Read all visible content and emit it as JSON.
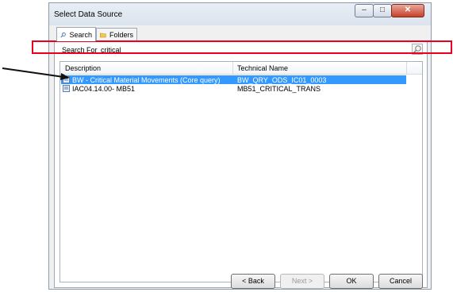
{
  "window": {
    "title": "Select Data Source"
  },
  "tabs": [
    {
      "label": "Search",
      "icon": "search-icon"
    },
    {
      "label": "Folders",
      "icon": "folder-icon"
    }
  ],
  "search": {
    "label": "Search For",
    "value": "critical"
  },
  "grid": {
    "columns": [
      "Description",
      "Technical Name"
    ],
    "rows": [
      {
        "description": "BW - Critical Material Movements (Core query)",
        "technical_name": "BW_QRY_ODS_IC01_0003",
        "selected": true
      },
      {
        "description": "IAC04.14.00- MB51",
        "technical_name": "MB51_CRITICAL_TRANS",
        "selected": false
      }
    ]
  },
  "buttons": {
    "back": "< Back",
    "next": "Next >",
    "ok": "OK",
    "cancel": "Cancel"
  },
  "colors": {
    "selection": "#3399ff",
    "highlight_box": "#e8001c"
  }
}
